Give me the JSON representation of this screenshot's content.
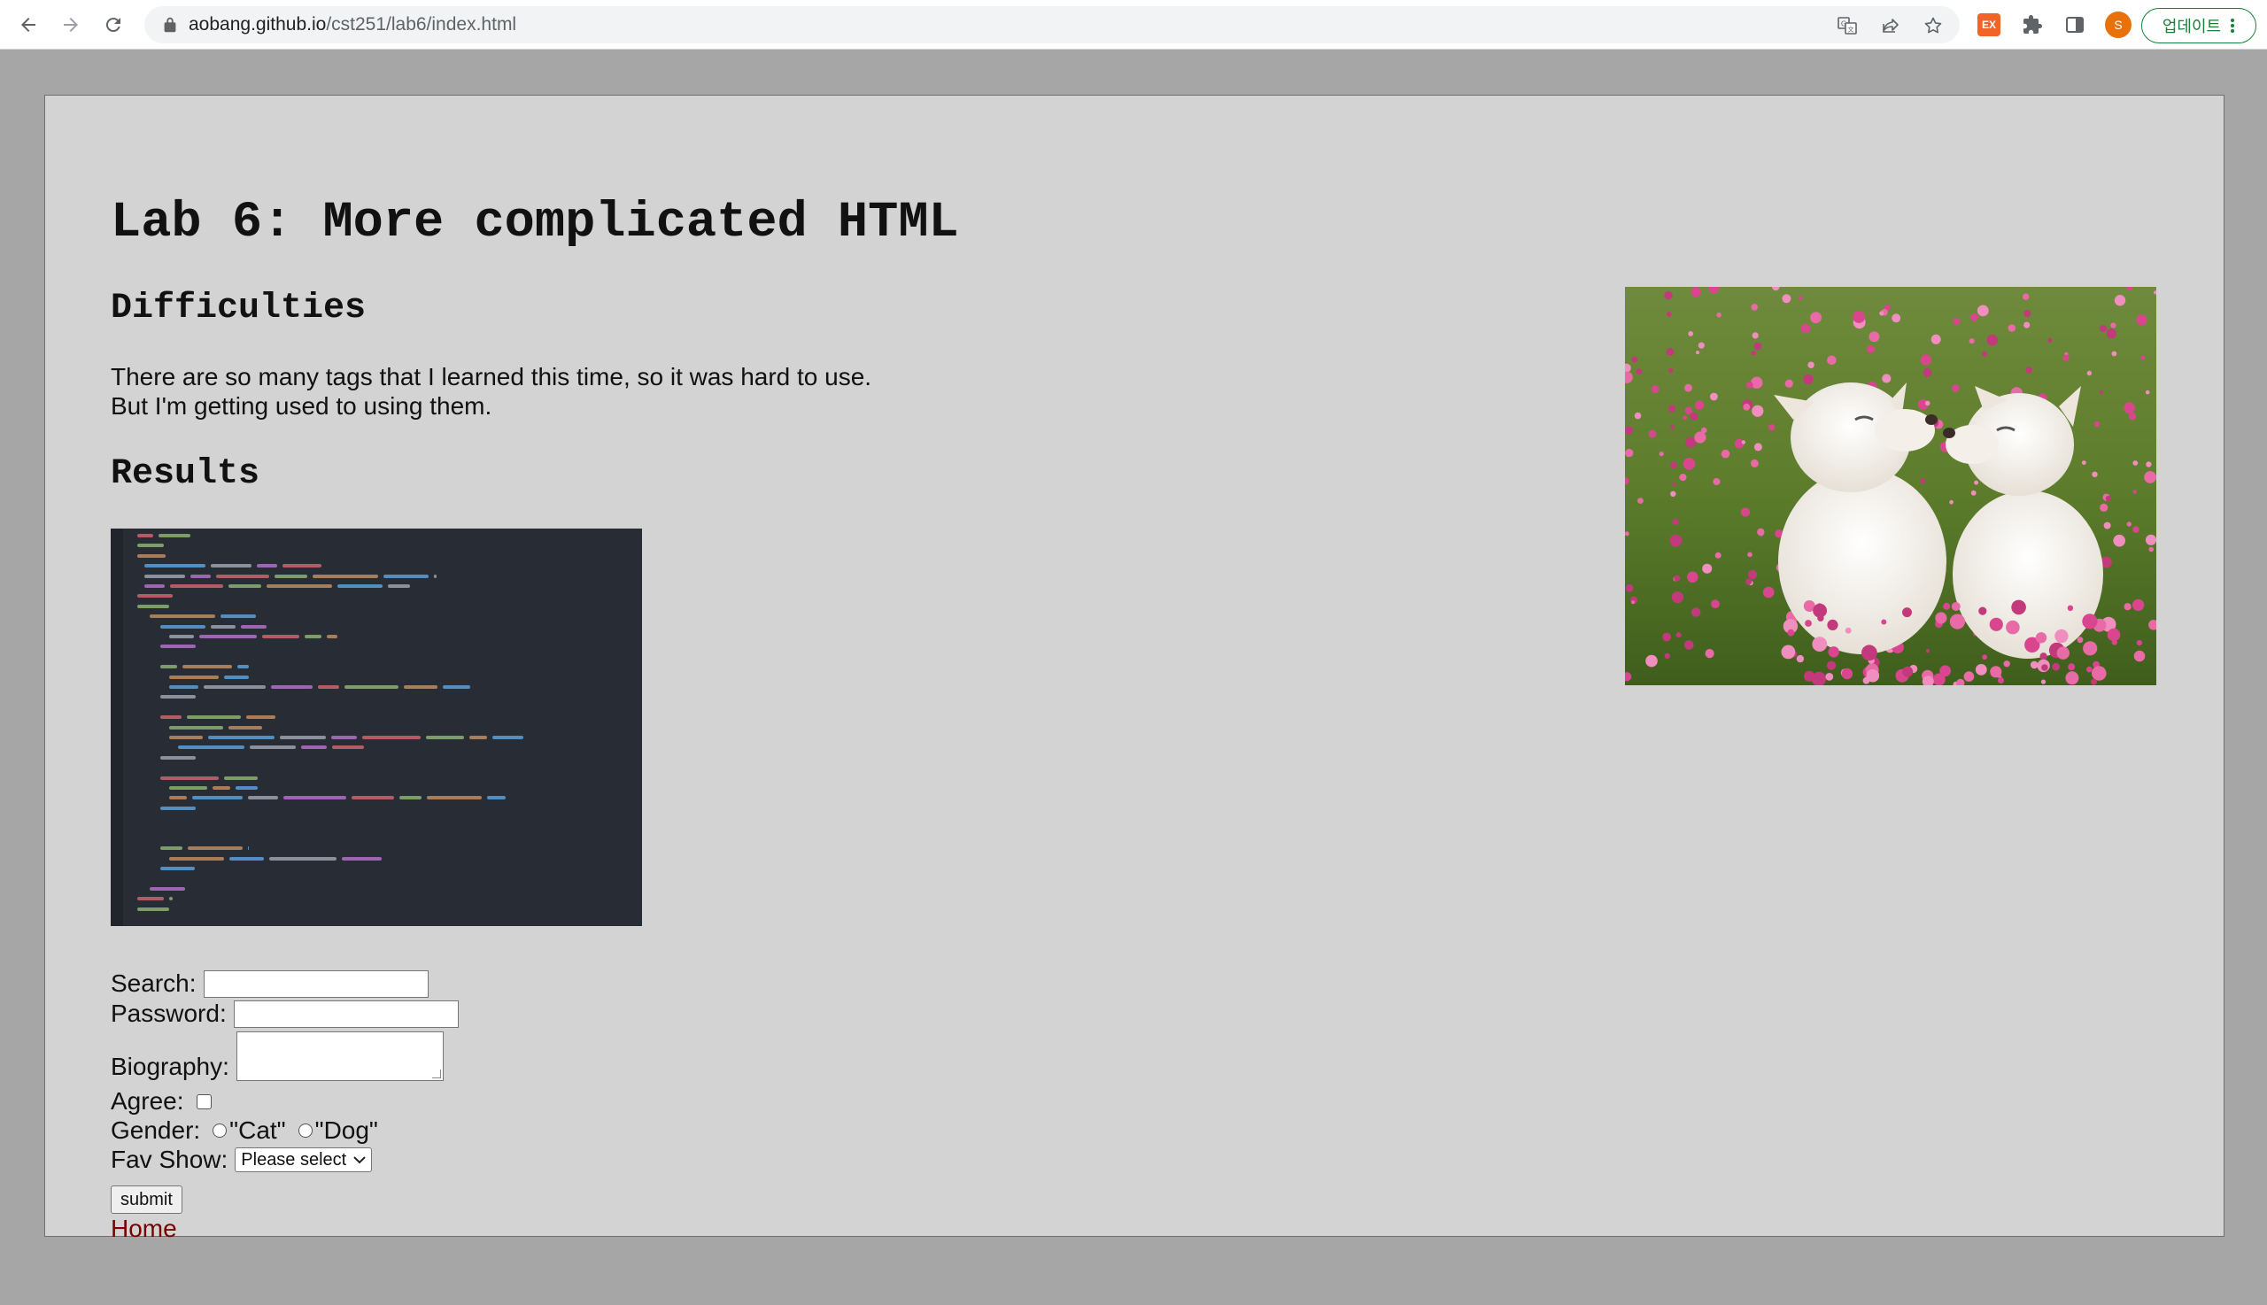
{
  "browser": {
    "url_host": "aobang.github.io",
    "url_path": "/cst251/lab6/index.html",
    "update_label": "업데이트",
    "extension_badge": "EX",
    "profile_initial": "S"
  },
  "page": {
    "title": "Lab 6: More complicated HTML",
    "difficulties_heading": "Difficulties",
    "difficulties_text_line1": "There are so many tags that I learned this time, so it was hard to use.",
    "difficulties_text_line2": "But I'm getting used to using them.",
    "results_heading": "Results"
  },
  "form": {
    "search_label": "Search:",
    "password_label": "Password:",
    "biography_label": "Biography:",
    "agree_label": "Agree:",
    "gender_label": "Gender:",
    "gender_options": [
      "\"Cat\"",
      "\"Dog\""
    ],
    "fav_show_label": "Fav Show:",
    "fav_show_selected": "Please select",
    "submit_label": "submit",
    "home_link": "Home"
  },
  "icons": {
    "back": "arrow-left-icon",
    "forward": "arrow-right-icon",
    "reload": "reload-icon",
    "lock": "lock-icon",
    "translate": "translate-icon",
    "share": "share-icon",
    "bookmark": "star-icon",
    "extensions": "puzzle-icon",
    "side_panel": "side-panel-icon"
  },
  "colors": {
    "page_background": "#a6a6a6",
    "content_background": "#d3d3d3",
    "link_color": "#7a0000",
    "update_accent": "#188038"
  }
}
